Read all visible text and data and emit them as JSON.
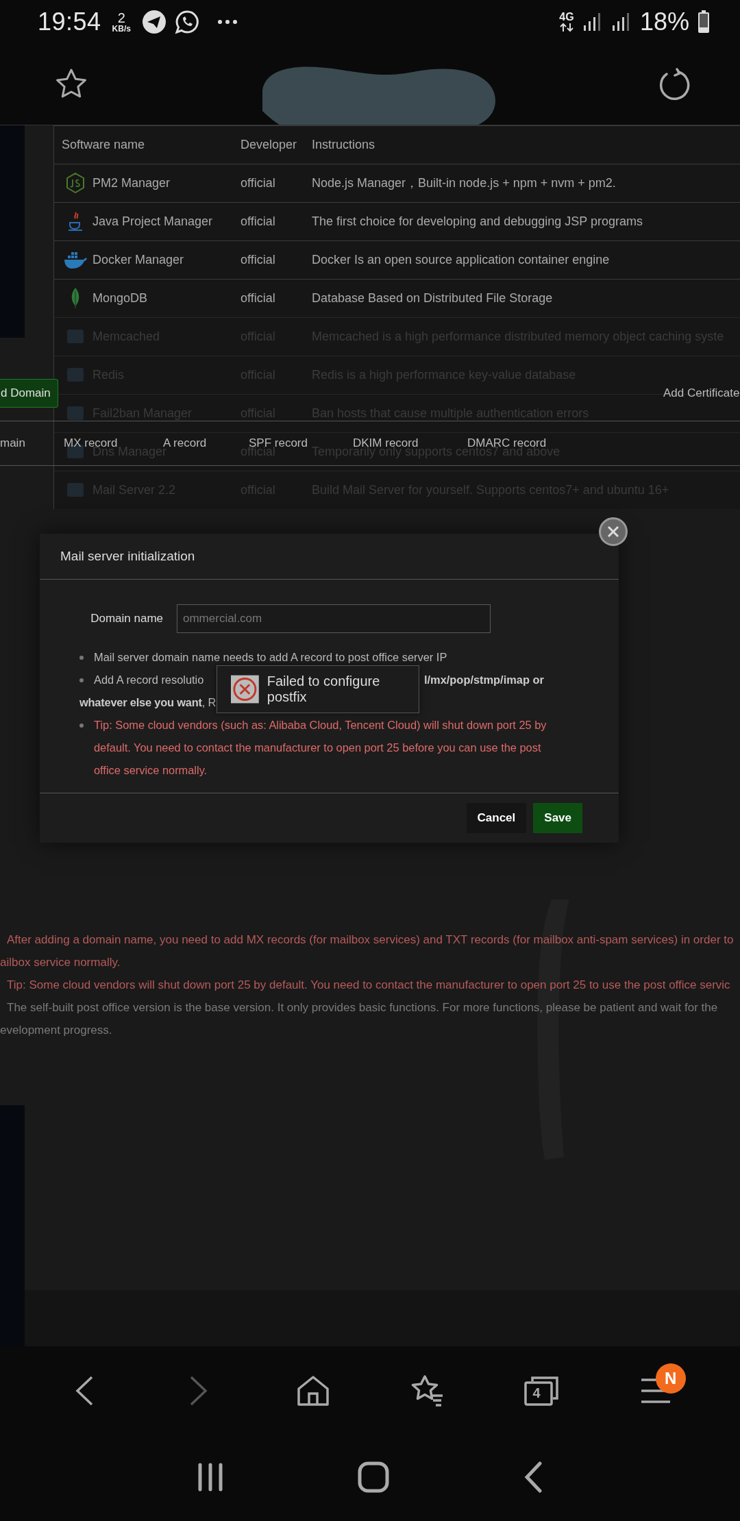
{
  "status_bar": {
    "time": "19:54",
    "speed_value": "2",
    "speed_unit": "KB/s",
    "network": "4G",
    "battery": "18%"
  },
  "software_table": {
    "columns": [
      "Software name",
      "Developer",
      "Instructions"
    ],
    "rows": [
      {
        "name": "PM2 Manager",
        "developer": "official",
        "instructions": "Node.js Manager，Built-in node.js + npm + nvm + pm2.",
        "dimmed": false
      },
      {
        "name": "Java Project Manager",
        "developer": "official",
        "instructions": "The first choice for developing and debugging JSP programs",
        "dimmed": false
      },
      {
        "name": "Docker Manager",
        "developer": "official",
        "instructions": "Docker Is an open source application container engine",
        "dimmed": false
      },
      {
        "name": "MongoDB",
        "developer": "official",
        "instructions": "Database Based on Distributed File Storage",
        "dimmed": false
      },
      {
        "name": "Memcached",
        "developer": "official",
        "instructions": "Memcached is a high performance distributed memory object caching syste",
        "dimmed": true
      },
      {
        "name": "Redis",
        "developer": "official",
        "instructions": "Redis is a high performance key-value database",
        "dimmed": true
      },
      {
        "name": "Fail2ban Manager",
        "developer": "official",
        "instructions": "Ban hosts that cause multiple authentication errors",
        "dimmed": true
      },
      {
        "name": "Dns Manager",
        "developer": "official",
        "instructions": "Temporarily only supports centos7 and above",
        "dimmed": true
      },
      {
        "name": "Mail Server 2.2",
        "developer": "official",
        "instructions": "Build Mail Server for yourself. Supports centos7+ and ubuntu 16+",
        "dimmed": true
      }
    ]
  },
  "mail_page": {
    "add_domain_button": "d Domain",
    "add_certificate_button": "Add Certificate",
    "record_columns": [
      "main",
      "MX record",
      "A record",
      "SPF record",
      "DKIM record",
      "DMARC record"
    ],
    "notes": [
      {
        "kind": "warning",
        "text": "After adding a domain name, you need to add MX records (for mailbox services) and TXT records (for mailbox anti-spam services) in order to"
      },
      {
        "kind": "warning",
        "text": "ailbox service normally."
      },
      {
        "kind": "warning",
        "text": "Tip: Some cloud vendors will shut down port 25 by default. You need to contact the manufacturer to open port 25 to use the post office servic"
      },
      {
        "kind": "info",
        "text": "The self-built post office version is the base version. It only provides basic functions. For more functions, please be patient and wait for the"
      },
      {
        "kind": "info",
        "text": "evelopment progress."
      }
    ]
  },
  "modal": {
    "title": "Mail server initialization",
    "domain_label": "Domain name",
    "domain_value": "ommercial.com",
    "bullets": [
      {
        "kind": "info",
        "text": "Mail server domain name needs to add A record to post office server IP"
      },
      {
        "kind": "info",
        "text": "Add A record resolutio",
        "text_after": "l/mx/pop/stmp/imap or",
        "text_line2": "**whatever else you want**, R"
      },
      {
        "kind": "warning",
        "text": "Tip: Some cloud vendors (such as: Alibaba Cloud, Tencent Cloud) will shut down port 25 by default. You need to contact the manufacturer to open port 25 before you can use the post office service normally."
      }
    ],
    "buttons": [
      {
        "kind": "cancel",
        "label": "Cancel"
      },
      {
        "kind": "save",
        "label": "Save"
      }
    ]
  },
  "toast": {
    "text": "Failed to configure postfix"
  },
  "browser_toolbar": {
    "tab_count": "4",
    "menu_badge": "N"
  }
}
